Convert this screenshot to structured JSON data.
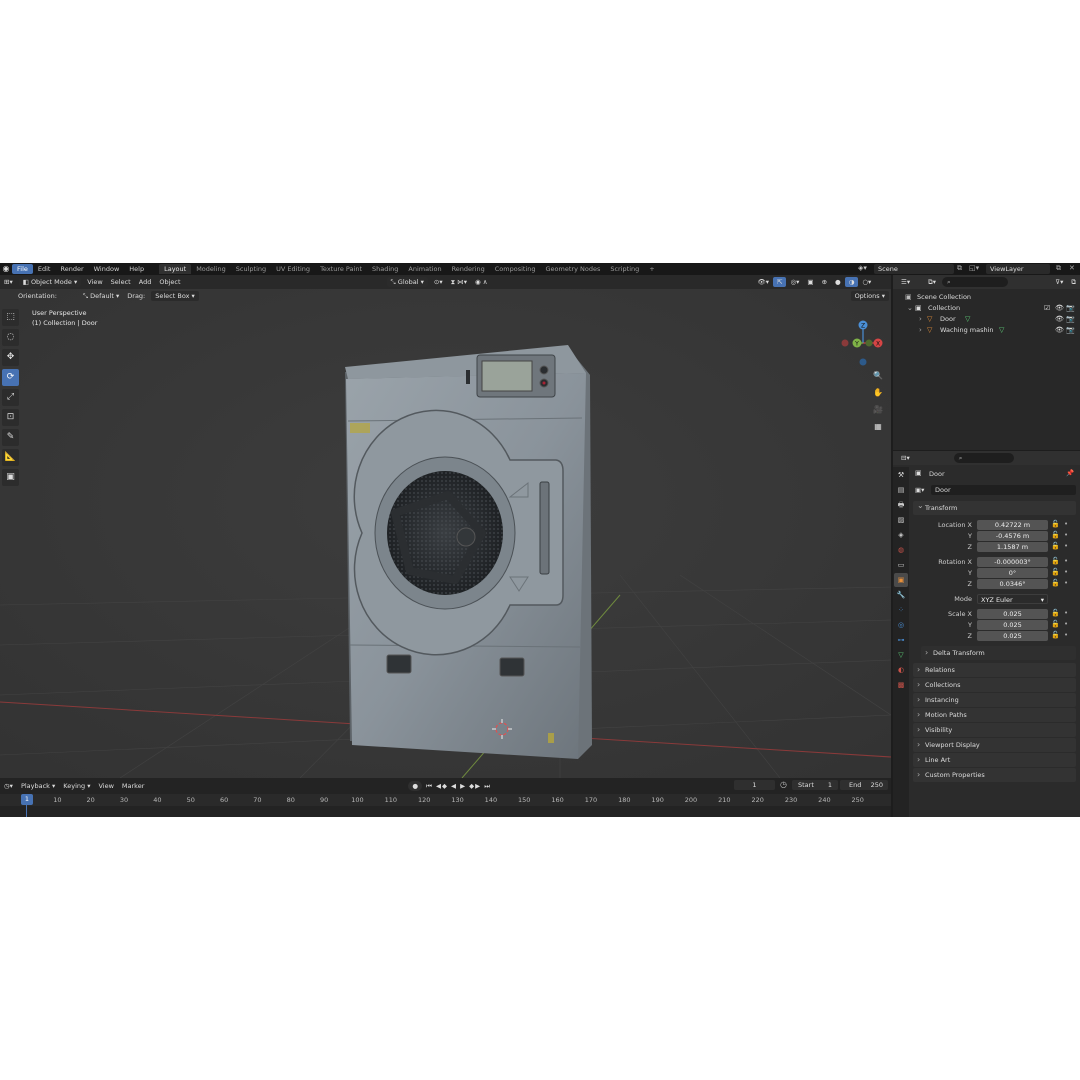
{
  "topbar": {
    "menus": [
      "File",
      "Edit",
      "Render",
      "Window",
      "Help"
    ],
    "workspaces": [
      "Layout",
      "Modeling",
      "Sculpting",
      "UV Editing",
      "Texture Paint",
      "Shading",
      "Animation",
      "Rendering",
      "Compositing",
      "Geometry Nodes",
      "Scripting"
    ],
    "add_tab": "+",
    "scene": "Scene",
    "view_layer": "ViewLayer"
  },
  "viewport": {
    "mode": "Object Mode",
    "menus": [
      "View",
      "Select",
      "Add",
      "Object"
    ],
    "transform_orientation": "Global",
    "orientation_label": "Orientation:",
    "orientation_value": "Default",
    "drag_label": "Drag:",
    "drag_value": "Select Box",
    "options": "Options",
    "info_line1": "User Perspective",
    "info_line2": "(1) Collection | Door",
    "gizmo_x": "X",
    "gizmo_y": "Y",
    "gizmo_z": "Z"
  },
  "timeline": {
    "menus": [
      "Playback",
      "Keying",
      "View",
      "Marker"
    ],
    "current_frame": "1",
    "start_label": "Start",
    "start": "1",
    "end_label": "End",
    "end": "250",
    "ticks": [
      "10",
      "20",
      "30",
      "40",
      "50",
      "60",
      "70",
      "80",
      "90",
      "100",
      "110",
      "120",
      "130",
      "140",
      "150",
      "160",
      "170",
      "180",
      "190",
      "200",
      "210",
      "220",
      "230",
      "240",
      "250"
    ]
  },
  "outliner": {
    "scene_collection": "Scene Collection",
    "collection": "Collection",
    "items": [
      "Door",
      "Waching mashin"
    ]
  },
  "properties": {
    "object_name": "Door",
    "data_name": "Door",
    "transform_panel": "Transform",
    "location_label": "Location X",
    "location": [
      "0.42722 m",
      "-0.4576 m",
      "1.1587 m"
    ],
    "rotation_label": "Rotation X",
    "rotation": [
      "-0.000003°",
      "0°",
      "0.0346°"
    ],
    "mode_label": "Mode",
    "mode_value": "XYZ Euler",
    "scale_label": "Scale X",
    "scale": [
      "0.025",
      "0.025",
      "0.025"
    ],
    "axis_y": "Y",
    "axis_z": "Z",
    "delta_transform": "Delta Transform",
    "panels": [
      "Relations",
      "Collections",
      "Instancing",
      "Motion Paths",
      "Visibility",
      "Viewport Display",
      "Line Art",
      "Custom Properties"
    ]
  },
  "colors": {
    "accent": "#4772b3",
    "x_axis": "#d64545",
    "y_axis": "#7fb347",
    "z_axis": "#4a8fd6"
  }
}
